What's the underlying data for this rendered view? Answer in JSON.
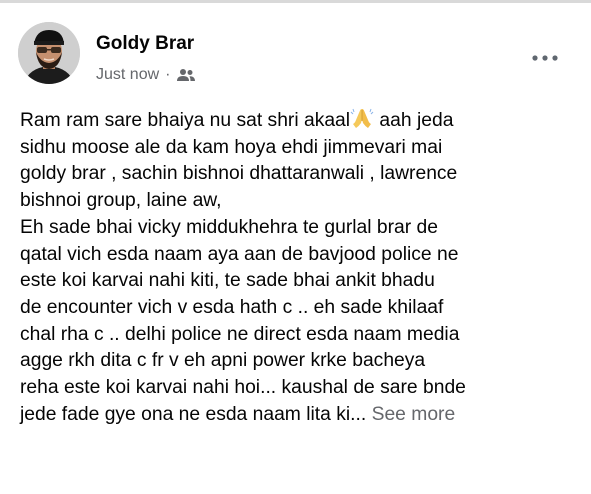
{
  "post": {
    "author": "Goldy Brar",
    "timestamp": "Just now",
    "separator": "·",
    "audience_icon": "friends-icon",
    "more_icon": "more-options-icon",
    "lines": [
      "Ram ram sare bhaiya nu sat shri akaal",
      " aah jeda",
      "sidhu moose ale da kam hoya ehdi jimmevari mai",
      "goldy brar , sachin bishnoi dhattaranwali , lawrence",
      "bishnoi group,  laine aw,",
      "Eh sade bhai vicky middukhehra te gurlal brar de",
      "qatal vich esda naam aya aan de bavjood police ne",
      "este koi karvai nahi kiti, te sade bhai ankit bhadu",
      "de encounter vich v esda hath c .. eh sade khilaaf",
      "chal rha c .. delhi police ne direct esda naam media",
      "agge rkh dita c fr v eh apni power krke bacheya",
      "reha este koi karvai nahi hoi... kaushal de sare bnde",
      "jede fade gye ona ne esda naam lita ki... "
    ],
    "emoji_name": "folded-hands-icon",
    "see_more": "See more"
  }
}
